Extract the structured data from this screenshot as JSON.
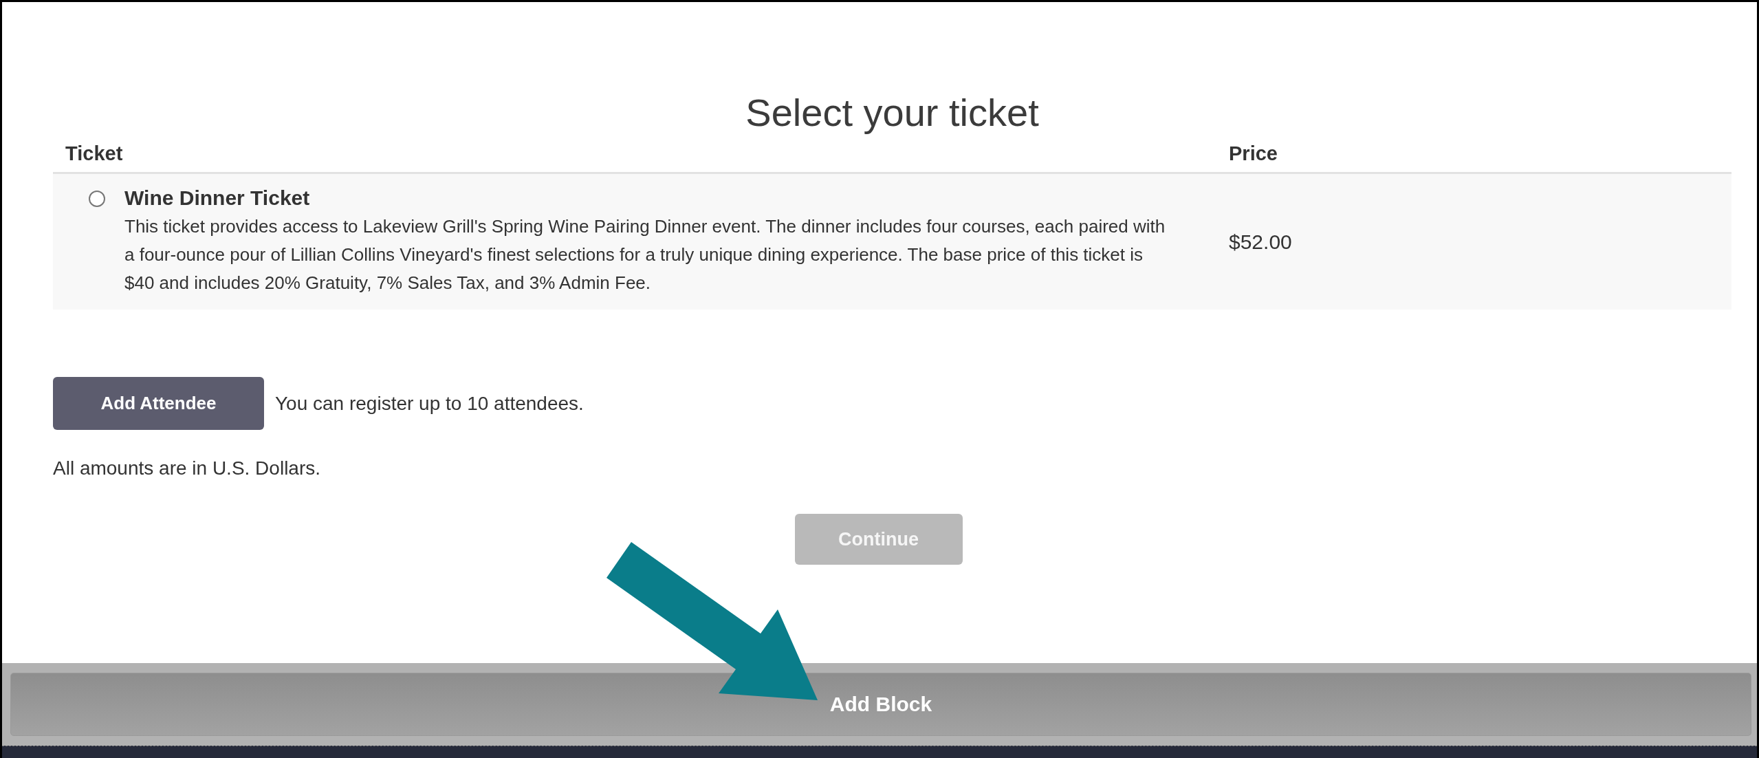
{
  "heading": "Select your ticket",
  "table": {
    "columns": [
      "Ticket",
      "Price"
    ],
    "rows": [
      {
        "name": "Wine Dinner Ticket",
        "description": "This ticket provides access to Lakeview Grill's Spring Wine Pairing Dinner event. The dinner includes four courses, each paired with a four-ounce pour of Lillian Collins Vineyard's finest selections for a truly unique dining experience. The base price of this ticket is $40 and includes 20% Gratuity, 7% Sales Tax, and 3% Admin Fee.",
        "price": "$52.00",
        "selected": false
      }
    ]
  },
  "add_attendee": {
    "label": "Add Attendee",
    "note": "You can register up to 10 attendees."
  },
  "currency_note": "All amounts are in U.S. Dollars.",
  "continue_button": {
    "label": "Continue",
    "disabled": true
  },
  "add_block_button": {
    "label": "Add Block"
  }
}
